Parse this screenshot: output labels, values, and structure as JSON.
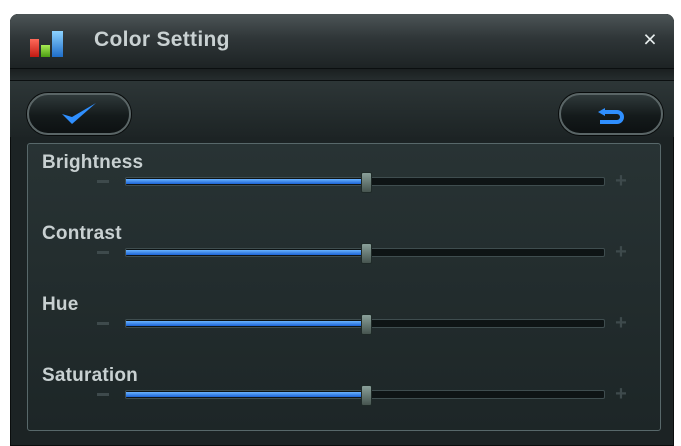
{
  "window": {
    "title": "Color Setting",
    "close_glyph": "×",
    "icon": "bar-chart-icon"
  },
  "toolbar": {
    "ok_icon": "checkmark-icon",
    "back_icon": "return-arrow-icon"
  },
  "sliders": [
    {
      "label": "Brightness",
      "value": 0.5
    },
    {
      "label": "Contrast",
      "value": 0.5
    },
    {
      "label": "Hue",
      "value": 0.5
    },
    {
      "label": "Saturation",
      "value": 0.5
    }
  ],
  "colors": {
    "accent_blue": "#2a7be6",
    "background": "#1c2324",
    "text": "#c8d0d1"
  }
}
